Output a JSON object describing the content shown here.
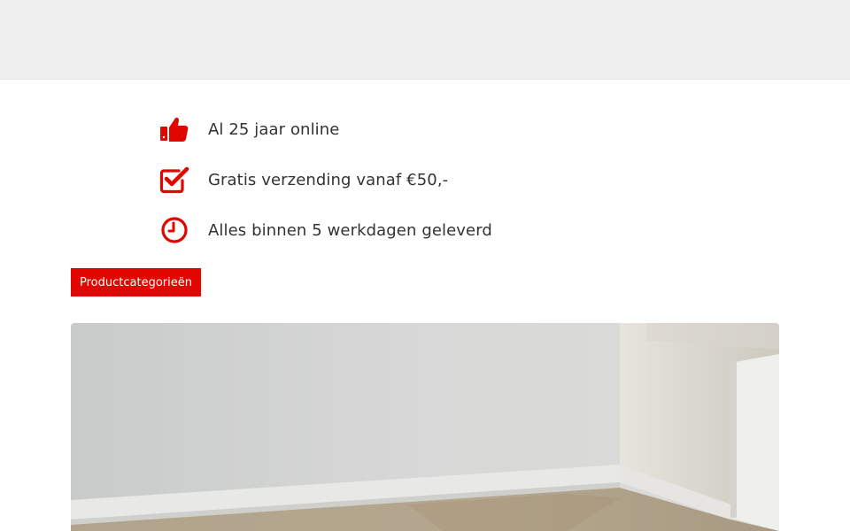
{
  "usps": [
    {
      "icon": "thumbs-up-icon",
      "text": "Al 25 jaar online"
    },
    {
      "icon": "check-square-icon",
      "text": "Gratis verzending vanaf €50,-"
    },
    {
      "icon": "clock-icon",
      "text": "Alles binnen 5 werkdagen geleverd"
    }
  ],
  "category_button": {
    "label": "Productcategorieën"
  },
  "colors": {
    "accent": "#e10600",
    "text": "#333333",
    "topbar": "#efefef"
  }
}
